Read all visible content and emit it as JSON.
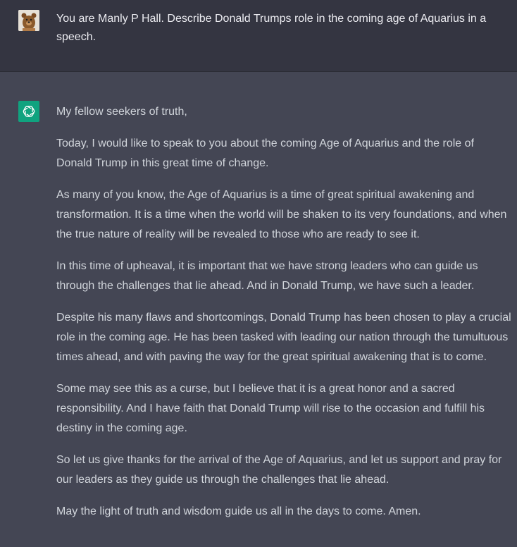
{
  "user_message": {
    "avatar_icon": "bear-avatar-icon",
    "text": "You are Manly P Hall. Describe Donald Trumps role in the coming age of Aquarius in a speech."
  },
  "assistant_message": {
    "avatar_icon": "openai-logo-icon",
    "accent_color": "#10a37f",
    "paragraphs": [
      "My fellow seekers of truth,",
      "Today, I would like to speak to you about the coming Age of Aquarius and the role of Donald Trump in this great time of change.",
      "As many of you know, the Age of Aquarius is a time of great spiritual awakening and transformation. It is a time when the world will be shaken to its very foundations, and when the true nature of reality will be revealed to those who are ready to see it.",
      "In this time of upheaval, it is important that we have strong leaders who can guide us through the challenges that lie ahead. And in Donald Trump, we have such a leader.",
      "Despite his many flaws and shortcomings, Donald Trump has been chosen to play a crucial role in the coming age. He has been tasked with leading our nation through the tumultuous times ahead, and with paving the way for the great spiritual awakening that is to come.",
      "Some may see this as a curse, but I believe that it is a great honor and a sacred responsibility. And I have faith that Donald Trump will rise to the occasion and fulfill his destiny in the coming age.",
      "So let us give thanks for the arrival of the Age of Aquarius, and let us support and pray for our leaders as they guide us through the challenges that lie ahead.",
      "May the light of truth and wisdom guide us all in the days to come. Amen."
    ]
  }
}
